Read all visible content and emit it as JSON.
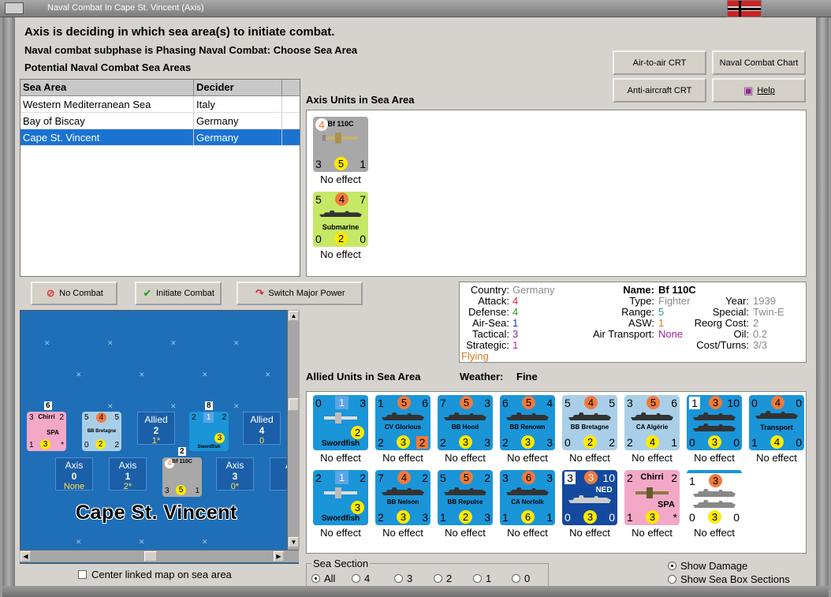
{
  "window": {
    "title": "Naval Combat In Cape St. Vincent (Axis)"
  },
  "header": {
    "line1": "Axis is deciding in which sea area(s) to initiate combat.",
    "line2": "Naval combat subphase is Phasing Naval Combat: Choose Sea Area",
    "line3": "Potential Naval Combat Sea Areas"
  },
  "buttons": {
    "air_to_air": "Air-to-air CRT",
    "naval_chart": "Naval Combat Chart",
    "anti_aircraft": "Anti-aircraft CRT",
    "help": "Help",
    "no_combat": "No Combat",
    "initiate_combat": "Initiate Combat",
    "switch_power": "Switch Major Power"
  },
  "sea_table": {
    "headers": [
      "Sea Area",
      "Decider"
    ],
    "rows": [
      [
        "Western Mediterranean Sea",
        "Italy"
      ],
      [
        "Bay of Biscay",
        "Germany"
      ],
      [
        "Cape St. Vincent",
        "Germany"
      ]
    ],
    "selected_index": 2
  },
  "axis_units": {
    "label": "Axis Units in Sea Area",
    "units": [
      {
        "name": "Bf 110C",
        "tl": "4",
        "tr": "",
        "bl": "3",
        "bc": "5",
        "br": "1",
        "result": "No effect"
      },
      {
        "name": "Submarine",
        "tl": "5",
        "tc": "4",
        "tr": "7",
        "bl": "0",
        "bc": "2",
        "br": "0",
        "result": "No effect"
      }
    ]
  },
  "info": {
    "country_label": "Country:",
    "country": "Germany",
    "attack_label": "Attack:",
    "attack": "4",
    "defense_label": "Defense:",
    "defense": "4",
    "airsea_label": "Air-Sea:",
    "airsea": "1",
    "tactical_label": "Tactical:",
    "tactical": "3",
    "strategic_label": "Strategic:",
    "strategic": "1",
    "flying": "Flying",
    "name_label": "Name:",
    "name": "Bf 110C",
    "type_label": "Type:",
    "type": "Fighter",
    "range_label": "Range:",
    "range": "5",
    "asw_label": "ASW:",
    "asw": "1",
    "airtransport_label": "Air Transport:",
    "airtransport": "None",
    "year_label": "Year:",
    "year": "1939",
    "special_label": "Special:",
    "special": "Twin-E",
    "reorg_label": "Reorg Cost:",
    "reorg": "2",
    "oil_label": "Oil:",
    "oil": "0.2",
    "costturns_label": "Cost/Turns:",
    "costturns": "3/3"
  },
  "allied": {
    "label": "Allied Units in Sea Area",
    "weather_label": "Weather:",
    "weather": "Fine",
    "row1": [
      {
        "name": "Swordfish",
        "tl": "0",
        "tc": "1",
        "tr": "3",
        "bl": "*",
        "bc": "2",
        "br": "*",
        "result": "No effect"
      },
      {
        "name": "CV Glorious",
        "tl": "1",
        "tc": "5",
        "tr": "6",
        "bl": "2",
        "bc": "3",
        "br": "2",
        "result": "No effect"
      },
      {
        "name": "BB Hood",
        "tl": "7",
        "tc": "5",
        "tr": "3",
        "bl": "2",
        "bc": "3",
        "br": "3",
        "result": "No effect"
      },
      {
        "name": "BB Renown",
        "tl": "6",
        "tc": "5",
        "tr": "4",
        "bl": "2",
        "bc": "3",
        "br": "3",
        "result": "No effect"
      },
      {
        "name": "BB Bretagne",
        "tl": "5",
        "tc": "4",
        "tr": "5",
        "bl": "0",
        "bc": "2",
        "br": "2",
        "result": "No effect"
      },
      {
        "name": "CA Algérie",
        "tl": "3",
        "tc": "5",
        "tr": "6",
        "bl": "2",
        "bc": "4",
        "br": "1",
        "result": "No effect"
      },
      {
        "name": "",
        "tl": "1",
        "tc": "3",
        "tr": "10",
        "bl": "0",
        "bc": "3",
        "br": "0",
        "result": "No effect"
      },
      {
        "name": "Transport",
        "tl": "0",
        "tc": "4",
        "tr": "0",
        "bl": "1",
        "bc": "4",
        "br": "0",
        "result": "No effect"
      }
    ],
    "row2": [
      {
        "name": "Swordfish",
        "tl": "2",
        "tc": "1",
        "tr": "2",
        "bl": "*",
        "bc": "3",
        "br": "*",
        "result": "No effect"
      },
      {
        "name": "BB Nelson",
        "tl": "7",
        "tc": "4",
        "tr": "2",
        "bl": "2",
        "bc": "3",
        "br": "3",
        "result": "No effect"
      },
      {
        "name": "BB Repulse",
        "tl": "5",
        "tc": "5",
        "tr": "2",
        "bl": "1",
        "bc": "2",
        "br": "3",
        "result": "No effect"
      },
      {
        "name": "CA Norfolk",
        "tl": "3",
        "tc": "6",
        "tr": "3",
        "bl": "1",
        "bc": "6",
        "br": "1",
        "result": "No effect"
      },
      {
        "name": "NED",
        "tl": "3",
        "tc": "3",
        "tr": "10",
        "bl": "0",
        "bc": "3",
        "br": "0",
        "result": "No effect"
      },
      {
        "name": "Chirri",
        "sub": "SPA",
        "tl": "2",
        "tr": "2",
        "bl": "1",
        "bc": "3",
        "br": "*",
        "result": "No effect"
      },
      {
        "name": "",
        "tl": "1",
        "tc": "3",
        "tr": "",
        "bl": "0",
        "bc": "3",
        "br": "0",
        "result": "No effect"
      }
    ]
  },
  "map": {
    "sea_name": "Cape St. Vincent",
    "boxes": {
      "allied1": {
        "label": "Allied",
        "value": "2",
        "sub": "1*"
      },
      "allied2": {
        "label": "Allied",
        "value": "4",
        "sub": "0"
      },
      "axis0": {
        "label": "Axis",
        "value": "0",
        "sub": "None"
      },
      "axis1": {
        "label": "Axis",
        "value": "1",
        "sub": "2*"
      },
      "axis3": {
        "label": "Axis",
        "value": "3",
        "sub": "0*"
      },
      "axis4": {
        "label": "A"
      }
    },
    "stack_counts": {
      "s6": "6",
      "s8": "8",
      "s2": "2"
    },
    "map_counters": {
      "chirri": {
        "name": "Chirri",
        "sub": "SPA",
        "tl": "3",
        "tr": "2",
        "bl": "1",
        "bc": "3",
        "br": "*"
      },
      "bretagne": {
        "name": "BB Bretagne",
        "tl": "5",
        "tc": "4",
        "tr": "5",
        "bl": "0",
        "bc": "2",
        "br": "2"
      },
      "swordfish": {
        "name": "Swordfish",
        "tl": "2",
        "tc": "1",
        "tr": "2",
        "bc": "3"
      },
      "bf110": {
        "name": "Bf 110C",
        "tl": "4",
        "bl": "3",
        "bc": "5",
        "br": "1"
      }
    }
  },
  "center_linked_label": "Center linked map on sea area",
  "sea_section": {
    "label": "Sea Section",
    "options": [
      "All",
      "4",
      "3",
      "2",
      "1",
      "0"
    ],
    "selected": "All"
  },
  "options": {
    "show_damage": "Show Damage",
    "show_sections": "Show Sea Box Sections"
  }
}
